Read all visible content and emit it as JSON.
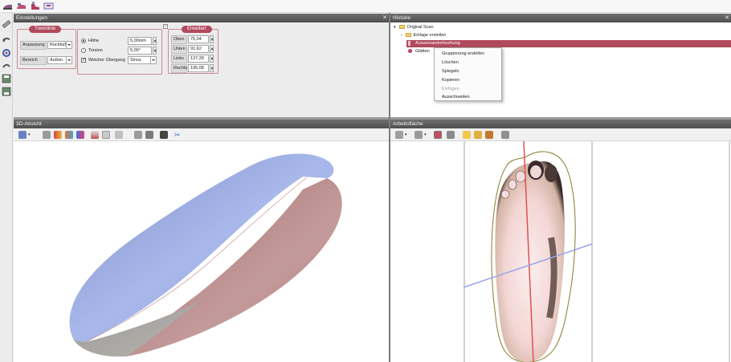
{
  "settings": {
    "title": "Einstellungen",
    "trennlinie": {
      "title": "Trennlinie",
      "anpassung_label": "Anpassung",
      "anpassung_value": "Rückfuß",
      "bereich_label": "Bereich",
      "bereich_value": "Außen"
    },
    "hoehe": {
      "hoehe_label": "Höhe",
      "hoehe_value": "5,00mm",
      "torsion_label": "Torsion",
      "torsion_value": "5,00°",
      "weich_label": "Weicher Übergang",
      "weich_value": "Sinus",
      "weich_checked": true
    },
    "erweitert": {
      "title": "Erweitert",
      "rows": [
        {
          "label": "Oben",
          "value": "75,04"
        },
        {
          "label": "Unten",
          "value": "91,62"
        },
        {
          "label": "Links",
          "value": "137,28"
        },
        {
          "label": "Rechts",
          "value": "195,08"
        }
      ]
    }
  },
  "history": {
    "title": "Historie",
    "nodes": {
      "root": "Original Scan",
      "child1": "Einlage erstellen",
      "child2": "Aussenranderhoehung",
      "child3": "Glätten"
    },
    "context_menu": [
      {
        "label": "Gruppierung erstellen",
        "enabled": true
      },
      {
        "label": "Löschen",
        "enabled": true
      },
      {
        "label": "Spiegeln",
        "enabled": true
      },
      {
        "label": "Kopieren",
        "enabled": true
      },
      {
        "label": "Einfügen",
        "enabled": false
      },
      {
        "label": "Ausschneiden",
        "enabled": true
      }
    ]
  },
  "view3d": {
    "title": "3D-Ansicht"
  },
  "workarea": {
    "title": "Arbeitsfläche"
  },
  "colors": {
    "accent": "#b34a5e",
    "selected_row": "#b04a5c",
    "insole_blue": "#8ea0d6",
    "insole_red": "#b98585",
    "axis_red": "#e05050",
    "axis_blue": "#9aa6e6"
  }
}
